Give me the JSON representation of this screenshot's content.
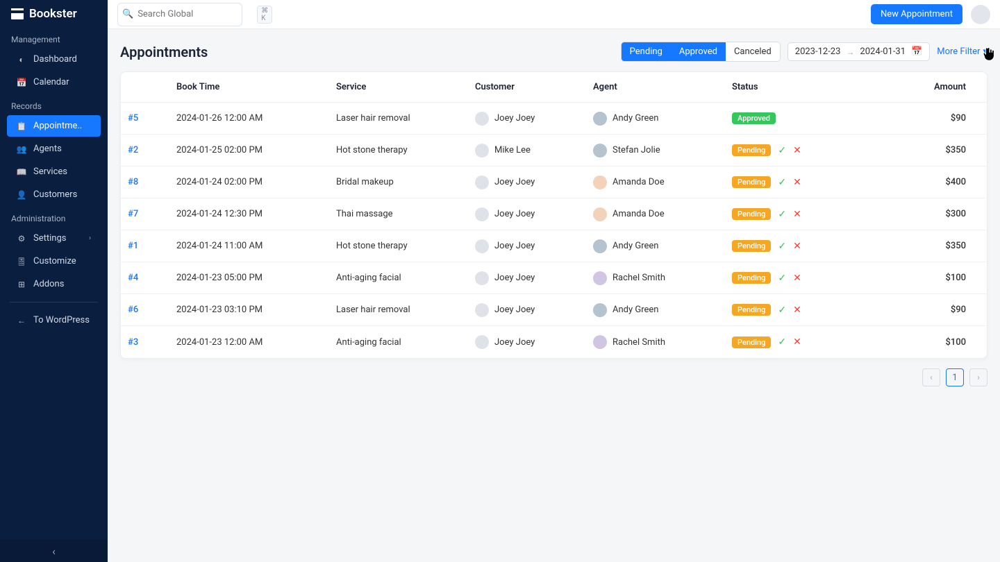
{
  "brand": "Bookster",
  "search": {
    "placeholder": "Search Global",
    "shortcut": "⌘ K"
  },
  "topbar": {
    "new_btn": "New Appointment"
  },
  "sidebar": {
    "sections": [
      {
        "title": "Management",
        "items": [
          {
            "icon": "speed",
            "label": "Dashboard"
          },
          {
            "icon": "cal",
            "label": "Calendar"
          }
        ]
      },
      {
        "title": "Records",
        "items": [
          {
            "icon": "appt",
            "label": "Appointme..",
            "active": true
          },
          {
            "icon": "agents",
            "label": "Agents"
          },
          {
            "icon": "svc",
            "label": "Services"
          },
          {
            "icon": "cust",
            "label": "Customers"
          }
        ]
      },
      {
        "title": "Administration",
        "items": [
          {
            "icon": "gear",
            "label": "Settings",
            "chev": true
          },
          {
            "icon": "tune",
            "label": "Customize"
          },
          {
            "icon": "addon",
            "label": "Addons"
          }
        ]
      }
    ],
    "back": "To WordPress"
  },
  "page": {
    "title": "Appointments",
    "filters": {
      "pending": "Pending",
      "approved": "Approved",
      "canceled": "Canceled"
    },
    "date_from": "2023-12-23",
    "date_to": "2024-01-31",
    "more_filter": "More Filter"
  },
  "columns": {
    "id": "",
    "book_time": "Book Time",
    "service": "Service",
    "customer": "Customer",
    "agent": "Agent",
    "status": "Status",
    "amount": "Amount"
  },
  "rows": [
    {
      "id": "#5",
      "time": "2024-01-26 12:00 AM",
      "service": "Laser hair removal",
      "customer": "Joey Joey",
      "agent": "Andy Green",
      "agent_av": "a1",
      "status": "Approved",
      "amount": "$90"
    },
    {
      "id": "#2",
      "time": "2024-01-25 02:00 PM",
      "service": "Hot stone therapy",
      "customer": "Mike Lee",
      "agent": "Stefan Jolie",
      "agent_av": "a1",
      "status": "Pending",
      "amount": "$350"
    },
    {
      "id": "#8",
      "time": "2024-01-24 02:00 PM",
      "service": "Bridal makeup",
      "customer": "Joey Joey",
      "agent": "Amanda Doe",
      "agent_av": "a3",
      "status": "Pending",
      "amount": "$400"
    },
    {
      "id": "#7",
      "time": "2024-01-24 12:30 PM",
      "service": "Thai massage",
      "customer": "Joey Joey",
      "agent": "Amanda Doe",
      "agent_av": "a3",
      "status": "Pending",
      "amount": "$300"
    },
    {
      "id": "#1",
      "time": "2024-01-24 11:00 AM",
      "service": "Hot stone therapy",
      "customer": "Joey Joey",
      "agent": "Andy Green",
      "agent_av": "a1",
      "status": "Pending",
      "amount": "$350"
    },
    {
      "id": "#4",
      "time": "2024-01-23 05:00 PM",
      "service": "Anti-aging facial",
      "customer": "Joey Joey",
      "agent": "Rachel Smith",
      "agent_av": "a2",
      "status": "Pending",
      "amount": "$100"
    },
    {
      "id": "#6",
      "time": "2024-01-23 03:10 PM",
      "service": "Laser hair removal",
      "customer": "Joey Joey",
      "agent": "Andy Green",
      "agent_av": "a1",
      "status": "Pending",
      "amount": "$90"
    },
    {
      "id": "#3",
      "time": "2024-01-23 12:00 AM",
      "service": "Anti-aging facial",
      "customer": "Joey Joey",
      "agent": "Rachel Smith",
      "agent_av": "a2",
      "status": "Pending",
      "amount": "$100"
    }
  ],
  "pager": {
    "current": "1"
  }
}
